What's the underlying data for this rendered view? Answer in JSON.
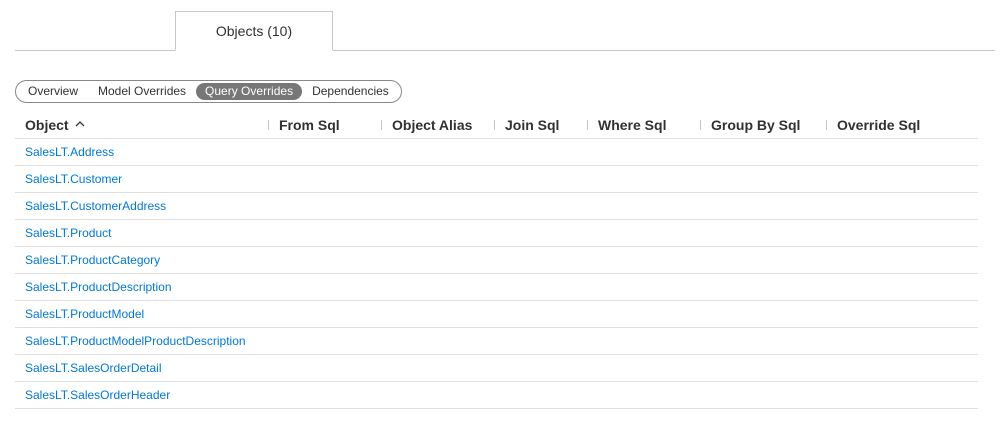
{
  "tabs": {
    "objects_label": "Objects (10)"
  },
  "views": {
    "items": [
      "Overview",
      "Model Overrides",
      "Query Overrides",
      "Dependencies"
    ],
    "active": "Query Overrides"
  },
  "table": {
    "columns": [
      "Object",
      "From Sql",
      "Object Alias",
      "Join Sql",
      "Where Sql",
      "Group By Sql",
      "Override Sql"
    ],
    "sort": {
      "column": "Object",
      "direction": "ascending",
      "icon": "chevron-up-icon"
    },
    "rows": [
      "SalesLT.Address",
      "SalesLT.Customer",
      "SalesLT.CustomerAddress",
      "SalesLT.Product",
      "SalesLT.ProductCategory",
      "SalesLT.ProductDescription",
      "SalesLT.ProductModel",
      "SalesLT.ProductModelProductDescription",
      "SalesLT.SalesOrderDetail",
      "SalesLT.SalesOrderHeader"
    ]
  },
  "colors": {
    "link": "#0078d4",
    "active_pill": "#777777",
    "border": "#c8c8c8"
  }
}
